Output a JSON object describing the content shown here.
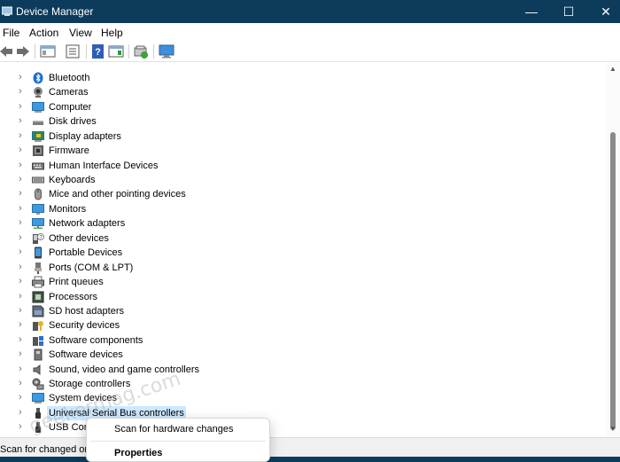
{
  "window": {
    "title": "Device Manager"
  },
  "titlebar": {
    "minimize": "—",
    "maximize": "☐",
    "close": "✕"
  },
  "menu": [
    "File",
    "Action",
    "View",
    "Help"
  ],
  "tree": {
    "items": [
      {
        "label": "Bluetooth",
        "icon": "bluetooth-icon"
      },
      {
        "label": "Cameras",
        "icon": "camera-icon"
      },
      {
        "label": "Computer",
        "icon": "computer-icon"
      },
      {
        "label": "Disk drives",
        "icon": "disk-drive-icon"
      },
      {
        "label": "Display adapters",
        "icon": "display-adapter-icon"
      },
      {
        "label": "Firmware",
        "icon": "firmware-icon"
      },
      {
        "label": "Human Interface Devices",
        "icon": "hid-icon"
      },
      {
        "label": "Keyboards",
        "icon": "keyboard-icon"
      },
      {
        "label": "Mice and other pointing devices",
        "icon": "mouse-icon"
      },
      {
        "label": "Monitors",
        "icon": "monitor-icon"
      },
      {
        "label": "Network adapters",
        "icon": "network-adapter-icon"
      },
      {
        "label": "Other devices",
        "icon": "other-devices-icon"
      },
      {
        "label": "Portable Devices",
        "icon": "portable-device-icon"
      },
      {
        "label": "Ports (COM & LPT)",
        "icon": "port-icon"
      },
      {
        "label": "Print queues",
        "icon": "printer-icon"
      },
      {
        "label": "Processors",
        "icon": "processor-icon"
      },
      {
        "label": "SD host adapters",
        "icon": "sd-card-icon"
      },
      {
        "label": "Security devices",
        "icon": "security-icon"
      },
      {
        "label": "Software components",
        "icon": "software-components-icon"
      },
      {
        "label": "Software devices",
        "icon": "software-devices-icon"
      },
      {
        "label": "Sound, video and game controllers",
        "icon": "speaker-icon"
      },
      {
        "label": "Storage controllers",
        "icon": "storage-controller-icon"
      },
      {
        "label": "System devices",
        "icon": "system-devices-icon"
      },
      {
        "label": "Universal Serial Bus controllers",
        "icon": "usb-icon",
        "selected": true
      },
      {
        "label": "USB Con",
        "icon": "usb-connector-icon"
      }
    ]
  },
  "status": {
    "text": "Scan for changed or"
  },
  "context_menu": {
    "items": [
      "Scan for hardware changes",
      "Properties"
    ]
  },
  "watermark": {
    "text": "geekermag.com"
  },
  "colors": {
    "titlebar": "#0d3b5c",
    "selection": "#cce8ff",
    "accent": "#0078d4"
  }
}
